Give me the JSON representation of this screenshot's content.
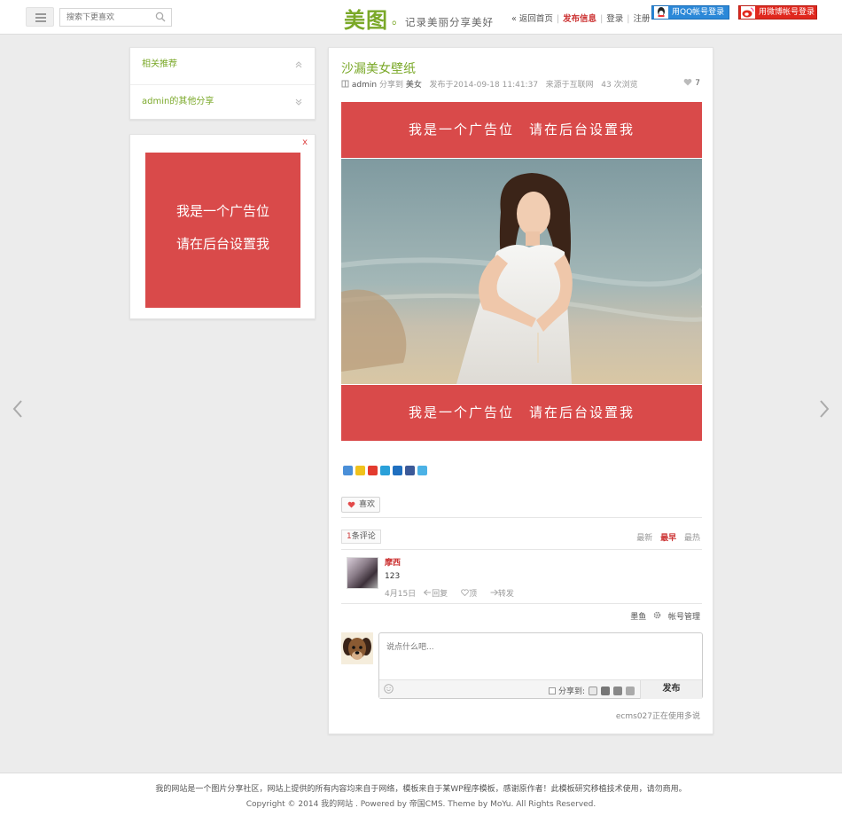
{
  "header": {
    "search_placeholder": "搜索下更喜欢",
    "logo": "美图",
    "logo_dot": "。",
    "tagline": "记录美丽分享美好",
    "nav_home": "« 返回首页",
    "nav_publish": "发布信息",
    "nav_login": "登录",
    "nav_register": "注册",
    "qq_login": "用QQ帐号登录",
    "weibo_login": "用微博帐号登录"
  },
  "sidebar": {
    "related": "相关推荐",
    "admin_shares": "admin的其他分享",
    "ad_close": "x",
    "ad_line1": "我是一个广告位",
    "ad_line2": "请在后台设置我"
  },
  "post": {
    "title": "沙漏美女壁纸",
    "author": "admin",
    "shared_to_label": "分享到",
    "category": "美女",
    "published": "发布于2014-09-18 11:41:37",
    "source": "来源于互联网",
    "views": "43 次浏览",
    "likes": "7",
    "banner_text": "我是一个广告位　请在后台设置我",
    "like_button": "喜欢"
  },
  "comments": {
    "count_num": "1",
    "count_label": "条评论",
    "sort_latest": "最新",
    "sort_earliest": "最早",
    "sort_hottest": "最热",
    "items": [
      {
        "name": "摩西",
        "text": "123",
        "date": "4月15日",
        "reply": "回复",
        "upvote": "顶",
        "forward": "转发"
      }
    ],
    "account_user": "墨鱼",
    "account_manage": "帐号管理",
    "input_placeholder": "说点什么吧...",
    "share_to": "分享到:",
    "publish": "发布",
    "powered": "ecms027正在使用多说"
  },
  "footer": {
    "line1": "我的网站是一个图片分享社区，网站上提供的所有内容均来自于网络，模板来自于某WP程序模板，感谢原作者！此模板研究移植技术使用，请勿商用。",
    "line2": "Copyright © 2014 我的网站 . Powered by 帝国CMS. Theme by MoYu. All Rights Reserved."
  },
  "colors": {
    "accent_green": "#7aa828",
    "ad_red": "#d94a4a",
    "highlight_red": "#cc3333"
  }
}
